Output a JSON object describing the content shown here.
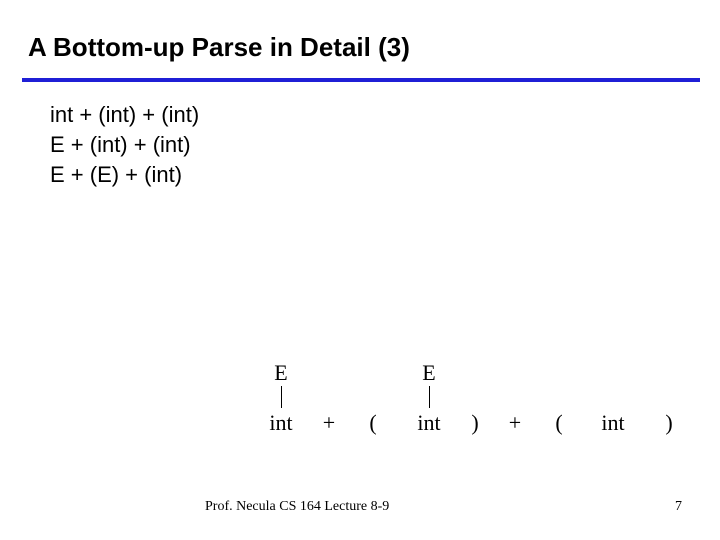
{
  "title": "A Bottom-up Parse in Detail (3)",
  "derivations": {
    "line1": "int + (int) + (int)",
    "line2": "E + (int) + (int)",
    "line3": "E  + (E) + (int)"
  },
  "tree": {
    "E1": "E",
    "E2": "E",
    "tok_int1": "int",
    "tok_plus1": "+",
    "tok_lpar1": "(",
    "tok_int2": "int",
    "tok_rpar1": ")",
    "tok_plus2": "+",
    "tok_lpar2": "(",
    "tok_int3": "int",
    "tok_rpar2": ")"
  },
  "footer": {
    "left": "Prof. Necula  CS 164  Lecture 8-9",
    "right": "7"
  }
}
